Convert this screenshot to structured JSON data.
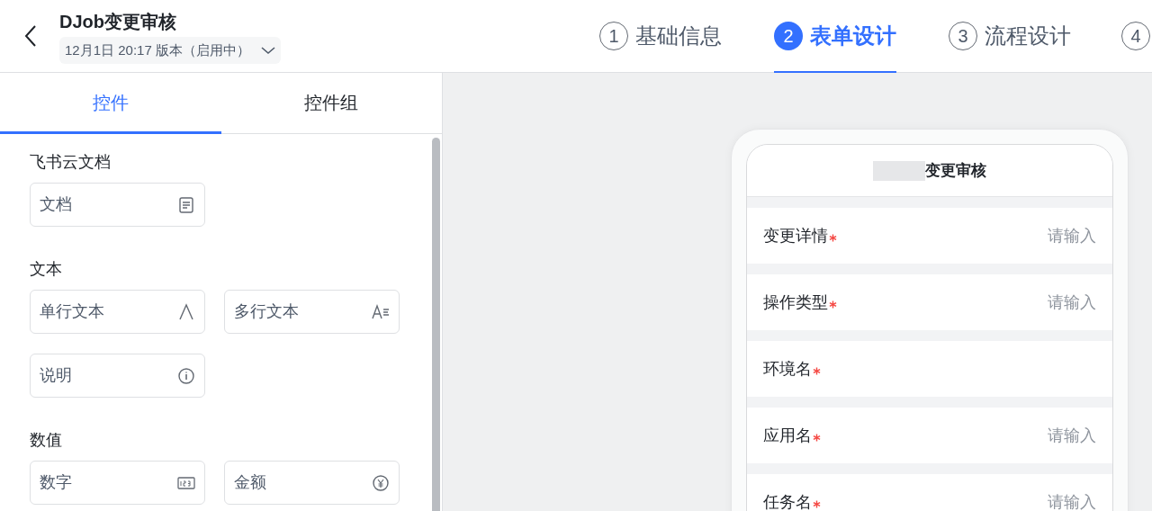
{
  "header": {
    "title": "DJob变更审核",
    "version": "12月1日 20:17 版本（启用中）"
  },
  "steps": [
    {
      "number": "1",
      "label": "基础信息",
      "selected": false
    },
    {
      "number": "2",
      "label": "表单设计",
      "selected": true
    },
    {
      "number": "3",
      "label": "流程设计",
      "selected": false
    },
    {
      "number": "4",
      "selected": false
    }
  ],
  "panel_tabs": [
    {
      "label": "控件",
      "selected": true
    },
    {
      "label": "控件组",
      "selected": false
    }
  ],
  "sections": [
    {
      "title": "飞书云文档",
      "items": [
        "文档"
      ]
    },
    {
      "title": "文本",
      "items": [
        "单行文本",
        "多行文本",
        "说明"
      ]
    },
    {
      "title": "数值",
      "items": [
        "数字",
        "金额"
      ]
    }
  ],
  "preview": {
    "title": "变更审核",
    "fields": [
      {
        "label": "变更详情",
        "required": true,
        "placeholder": "请输入"
      },
      {
        "label": "操作类型",
        "required": true,
        "placeholder": "请输入"
      },
      {
        "label": "环境名",
        "required": true
      },
      {
        "label": "应用名",
        "required": true,
        "placeholder": "请输入"
      },
      {
        "label": "任务名",
        "required": true,
        "placeholder": "请输入"
      }
    ]
  }
}
